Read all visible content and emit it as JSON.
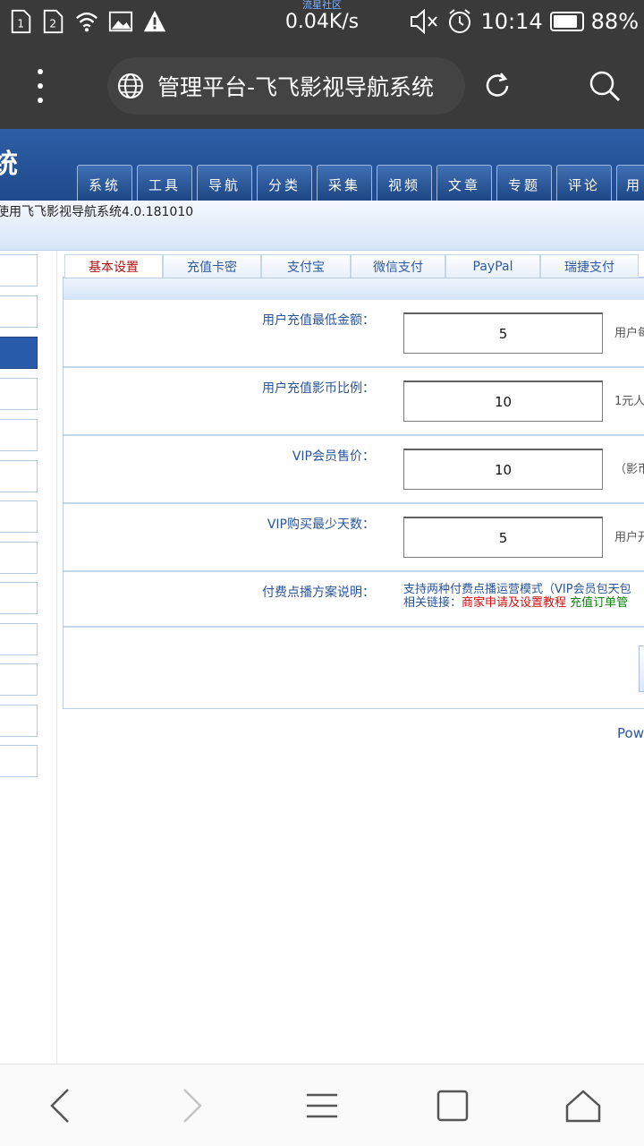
{
  "status_bar": {
    "network_label": "流星社区",
    "speed": "0.04K/s",
    "time": "10:14",
    "battery": "88%",
    "battery_level": 0.88,
    "icons": [
      "sim1-icon",
      "sim2-icon",
      "wifi-icon",
      "image-icon",
      "warning-icon",
      "mute-icon",
      "alarm-icon",
      "battery-icon"
    ]
  },
  "browser": {
    "title": "管理平台-飞飞影视导航系统",
    "icons": [
      "menu-dots-icon",
      "globe-icon",
      "reload-icon",
      "search-icon"
    ]
  },
  "header": {
    "logo_text": "统",
    "nav_tabs": [
      "系统",
      "工具",
      "导航",
      "分类",
      "采集",
      "视频",
      "文章",
      "专题",
      "评论",
      "用"
    ]
  },
  "infobar": {
    "text": "使用飞飞影视导航系统4.0.181010"
  },
  "sub_tabs": [
    "基本设置",
    "充值卡密",
    "支付宝",
    "微信支付",
    "PayPal",
    "瑞捷支付"
  ],
  "form": {
    "rows": [
      {
        "label": "用户充值最低金额：",
        "value": "5",
        "hint": "用户每"
      },
      {
        "label": "用户充值影币比例：",
        "value": "10",
        "hint": "1元人"
      },
      {
        "label": "VIP会员售价：",
        "value": "10",
        "hint": "（影币"
      },
      {
        "label": "VIP购买最少天数：",
        "value": "5",
        "hint": "用户开"
      }
    ],
    "desc": {
      "label": "付费点播方案说明：",
      "line1": "支持两种付费点播运营模式（VIP会员包天包",
      "line2_prefix": "相关链接：",
      "link1": "商家申请及设置教程",
      "link2": "充值订单管"
    }
  },
  "footer": {
    "powered": "Pow"
  },
  "bottom_nav": [
    "back-icon",
    "forward-icon",
    "menu-icon",
    "tabs-icon",
    "home-icon"
  ]
}
